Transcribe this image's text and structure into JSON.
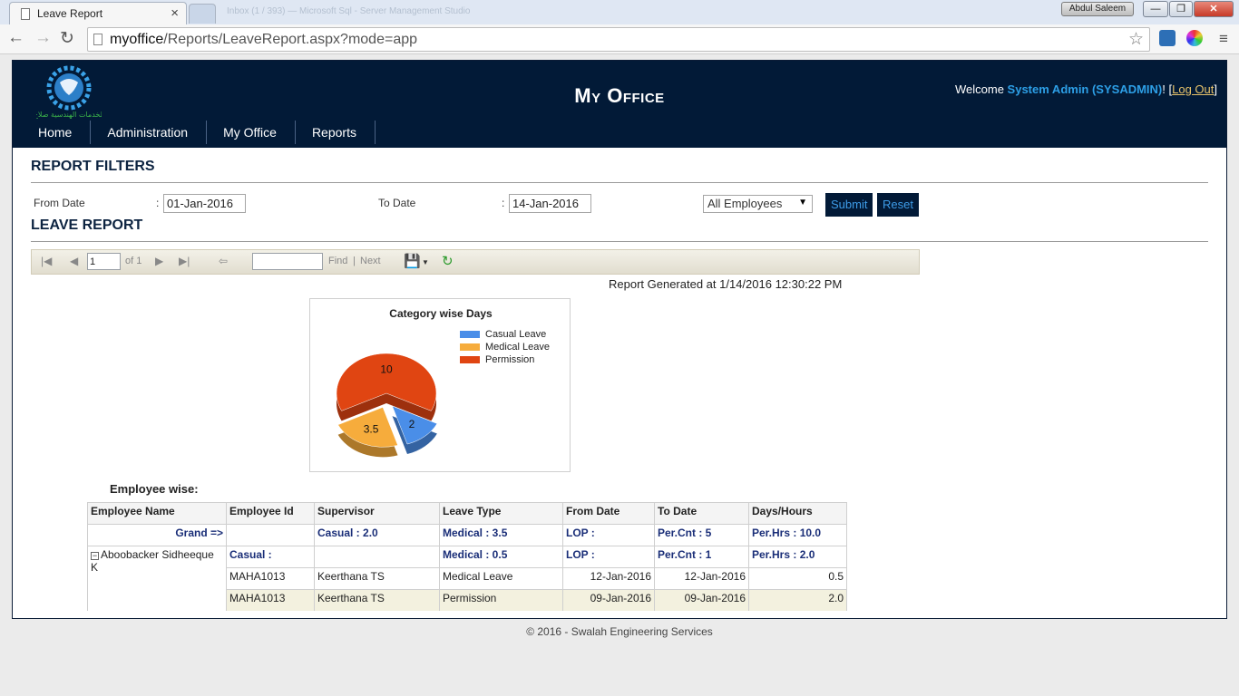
{
  "browser": {
    "tab_title": "Leave Report",
    "tab_close": "×",
    "ghost_tabs": "Inbox (1 / 393) — Microsoft Sql - Server Management Studio",
    "user_badge": "Abdul Saleem",
    "url_host": "myoffice",
    "url_path": "/Reports/LeaveReport.aspx?mode=app",
    "win_minimize": "—",
    "win_maximize": "❐",
    "win_close": "✕"
  },
  "header": {
    "brand": "My Office",
    "welcome_prefix": "Welcome ",
    "user_name": "System Admin (SYSADMIN)",
    "bang": "! [",
    "logout_label": "Log Out",
    "close_bracket": "]",
    "logo_caption": "الخدمات الهندسية صلاح"
  },
  "nav": {
    "items": [
      "Home",
      "Administration",
      "My Office",
      "Reports"
    ]
  },
  "filters": {
    "title": "REPORT FILTERS",
    "from_label": "From Date",
    "to_label": "To Date",
    "colon": ":",
    "from_value": "01-Jan-2016",
    "to_value": "14-Jan-2016",
    "employee_select": "All Employees",
    "submit_label": "Submit",
    "reset_label": "Reset"
  },
  "report": {
    "title": "LEAVE REPORT",
    "toolbar": {
      "page_value": "1",
      "of_pages": "of 1",
      "find_label": "Find",
      "sep": "|",
      "next_label": "Next"
    },
    "generated": "Report Generated at 1/14/2016 12:30:22 PM",
    "employee_wise_label": "Employee wise:",
    "columns": [
      "Employee Name",
      "Employee Id",
      "Supervisor",
      "Leave Type",
      "From Date",
      "To Date",
      "Days/Hours"
    ],
    "grand_row": [
      "Grand =>",
      "",
      "Casual : 2.0",
      "Medical : 3.5",
      "LOP :",
      "Per.Cnt : 5",
      "Per.Hrs : 10.0"
    ],
    "employee_name": "Aboobacker Sidheeque K",
    "expand_glyph": "−",
    "employee_summary": [
      "Casual :",
      "",
      "Medical : 0.5",
      "LOP :",
      "Per.Cnt : 1",
      "Per.Hrs : 2.0"
    ],
    "rows": [
      [
        "MAHA1013",
        "Keerthana  TS",
        "Medical Leave",
        "12-Jan-2016",
        "12-Jan-2016",
        "0.5"
      ],
      [
        "MAHA1013",
        "Keerthana  TS",
        "Permission",
        "09-Jan-2016",
        "09-Jan-2016",
        "2.0"
      ]
    ]
  },
  "chart_data": {
    "type": "pie",
    "title": "Category wise Days",
    "categories": [
      "Casual Leave",
      "Medical Leave",
      "Permission"
    ],
    "values": [
      2,
      3.5,
      10
    ],
    "labels": [
      "2",
      "3.5",
      "10"
    ],
    "colors": [
      "#4a8ee8",
      "#f6ac3c",
      "#e04512"
    ],
    "legend_position": "right"
  },
  "footer": {
    "text": "© 2016 - Swalah Engineering Services"
  }
}
